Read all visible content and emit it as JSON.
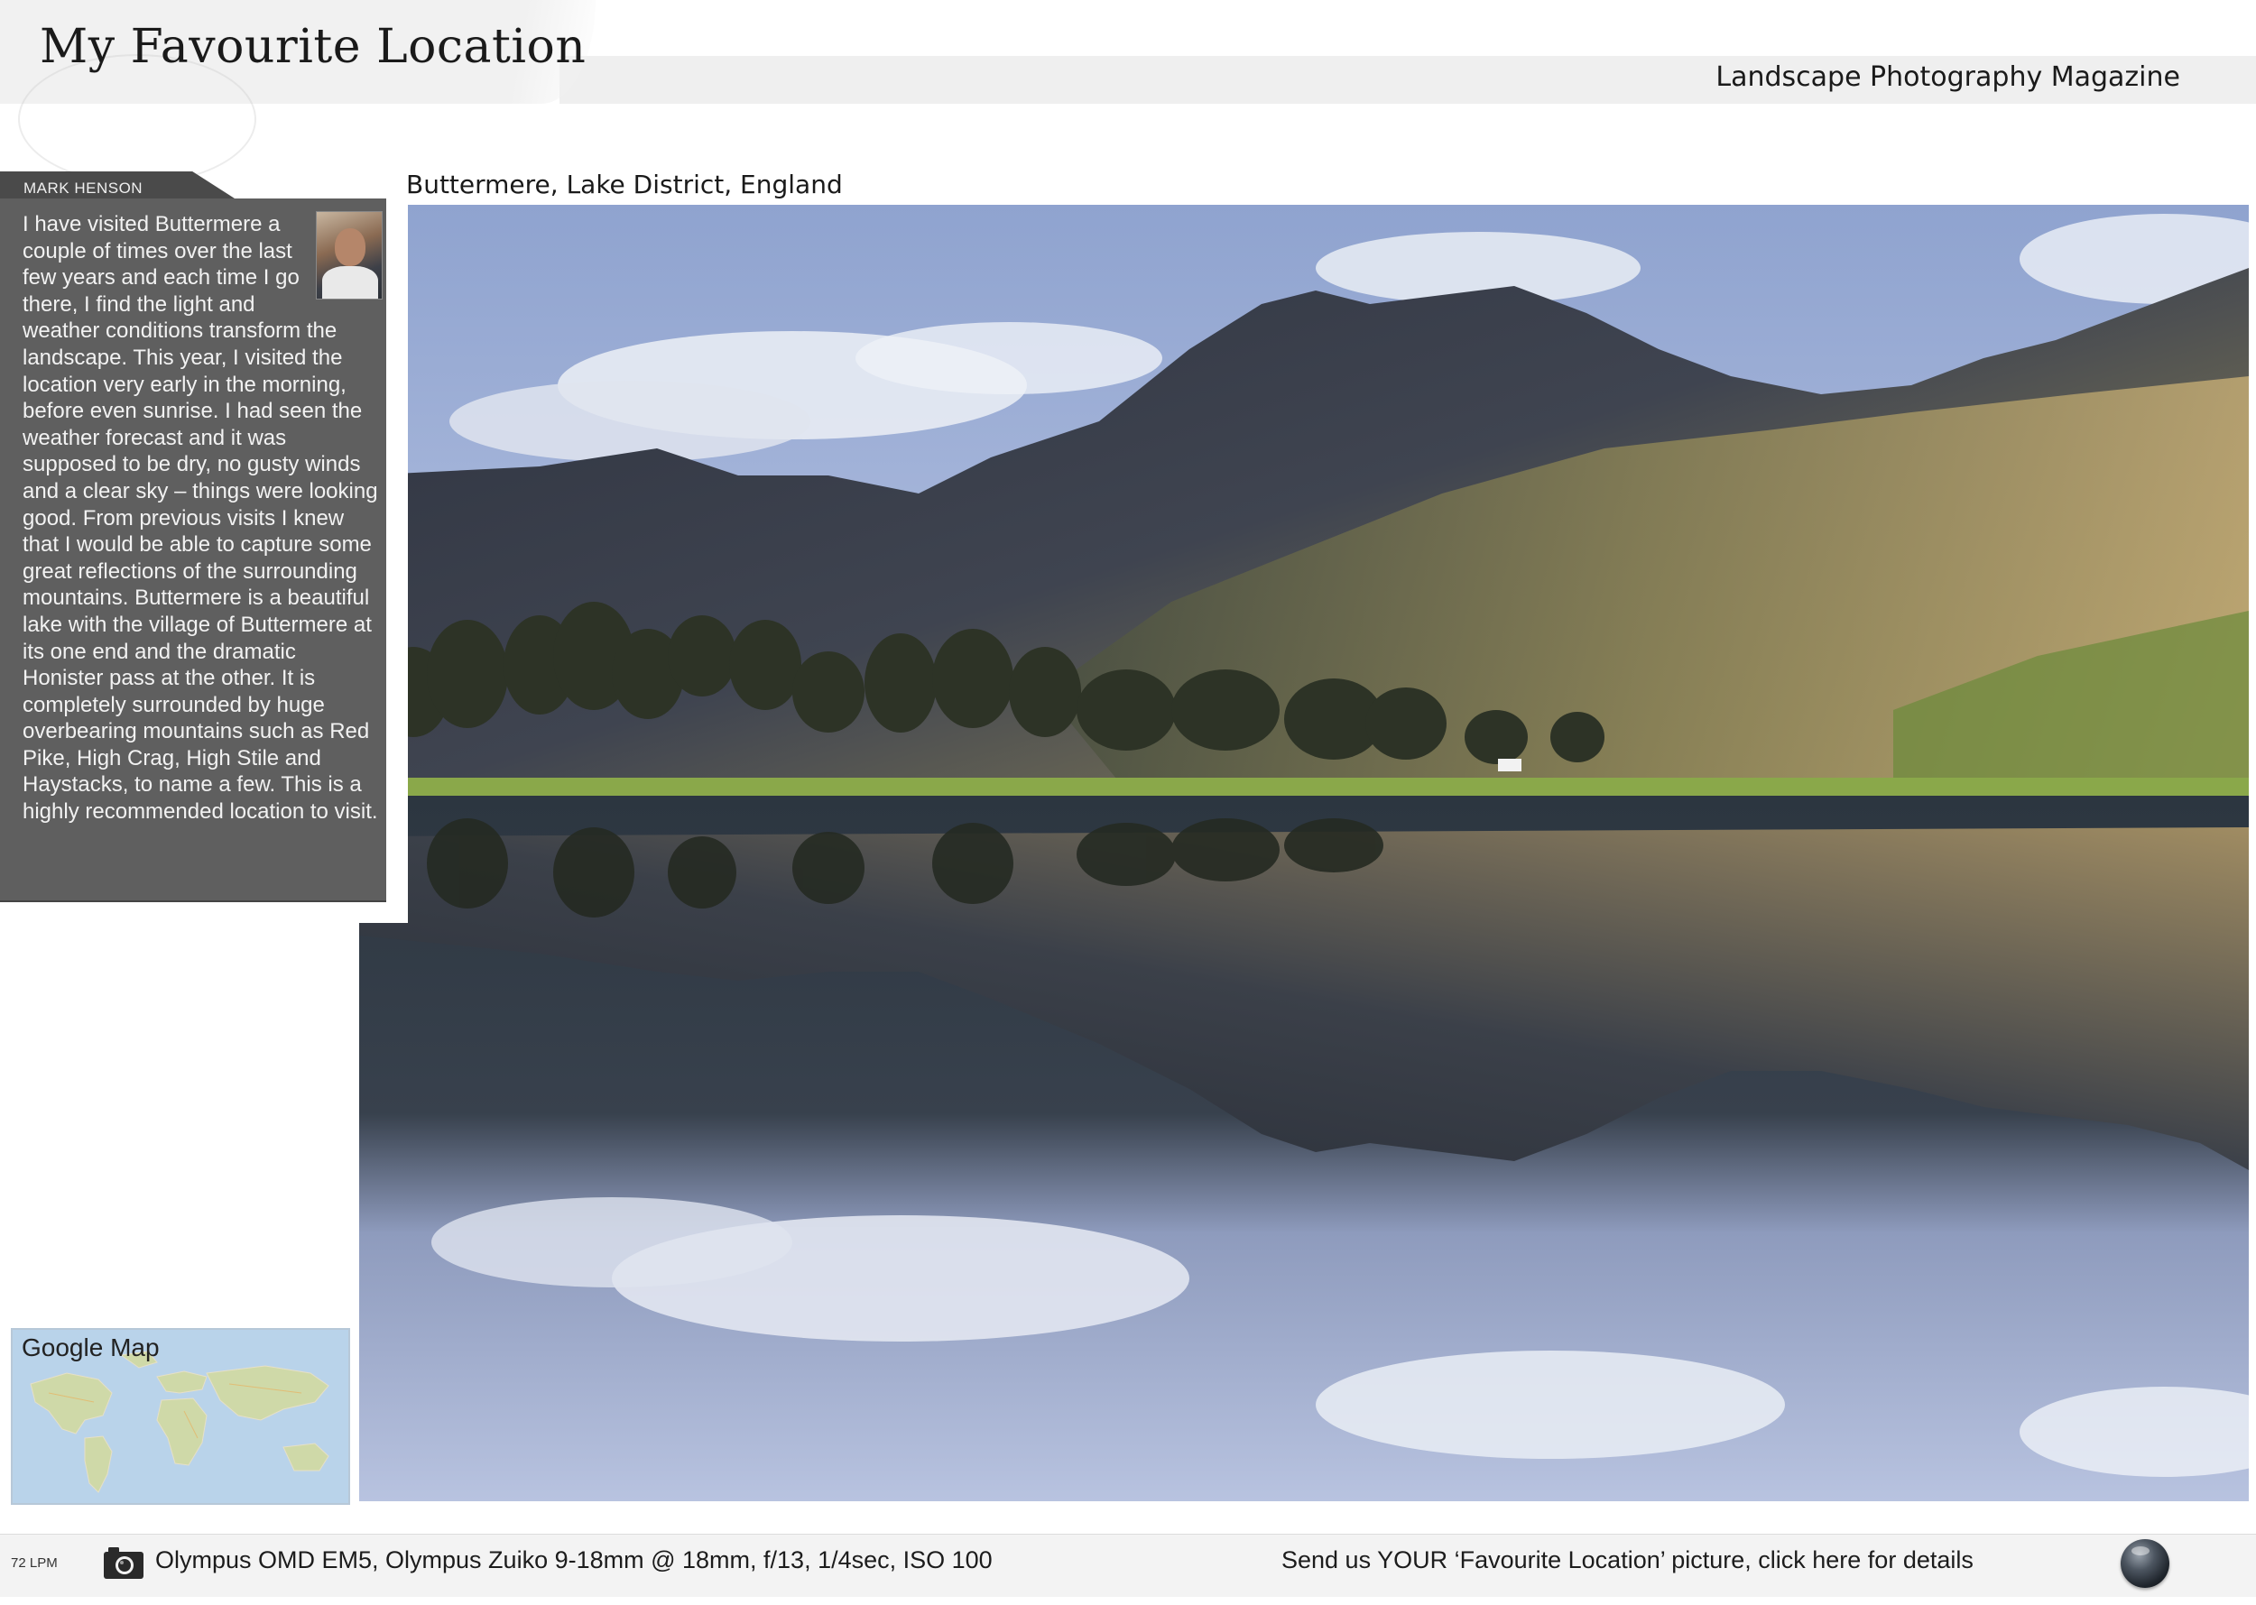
{
  "header": {
    "title": "My Favourite Location",
    "magazine": "Landscape Photography Magazine"
  },
  "author": {
    "name": "MARK HENSON",
    "bio": "I have visited Buttermere a couple of times over the last few years and each time I go there, I find the light and weather conditions transform the landscape. This year, I visited the location very early in the morning, before even sunrise. I had seen the weather forecast and it was supposed to be dry, no gusty winds and a clear sky – things were looking good. From previous visits I knew that I would be able to capture some great reflections of the surrounding mountains. Buttermere is a beautiful lake with the village of Buttermere at its one end and the dramatic Honister pass at the other. It is completely surrounded by huge overbearing mountains such as Red Pike, High Crag, High Stile and Haystacks, to name a few. This is a highly recommended location to visit."
  },
  "photo": {
    "caption": "Buttermere, Lake District, England"
  },
  "map": {
    "label": "Google Map"
  },
  "footer": {
    "badge": "72 LPM",
    "camera_details": "Olympus OMD EM5, Olympus Zuiko 9-18mm @ 18mm, f/13, 1/4sec, ISO 100",
    "send_link": "Send us YOUR ‘Favourite Location’ picture, click here for details"
  },
  "colors": {
    "author_card": "#5f5f5f",
    "header_band": "#efefef",
    "footer_band": "#f3f3f3"
  }
}
